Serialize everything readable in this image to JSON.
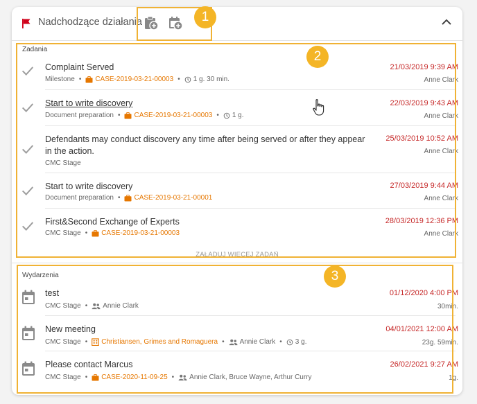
{
  "header": {
    "title": "Nadchodzące działania",
    "icons": [
      "flag-icon",
      "add-task-icon",
      "add-event-icon",
      "chevron-up-icon"
    ]
  },
  "annotations": {
    "b1": "1",
    "b2": "2",
    "b3": "3"
  },
  "colors": {
    "accent": "#f4b526",
    "date": "#c62828",
    "case": "#e67700",
    "flag": "#d0021b"
  },
  "tasks": {
    "label": "Zadania",
    "items": [
      {
        "title": "Complaint Served",
        "type": "Milestone",
        "case": "CASE-2019-03-21-00003",
        "duration": "1 g. 30 min.",
        "date": "21/03/2019 9:39 AM",
        "user": "Anne Clark"
      },
      {
        "title": "Start to write discovery",
        "type": "Document preparation",
        "case": "CASE-2019-03-21-00003",
        "duration": "1 g.",
        "date": "22/03/2019 9:43 AM",
        "user": "Anne Clark"
      },
      {
        "title1": "Defendants may conduct discovery any time after being served or after they appear",
        "title2": "in the action.",
        "type": "CMC Stage",
        "date": "25/03/2019 10:52 AM",
        "user": "Anne Clark"
      },
      {
        "title": "Start to write discovery",
        "type": "Document preparation",
        "case": "CASE-2019-03-21-00001",
        "date": "27/03/2019 9:44 AM",
        "user": "Anne Clark"
      },
      {
        "title": "First&Second Exchange of Experts",
        "type": "CMC Stage",
        "case": "CASE-2019-03-21-00003",
        "date": "28/03/2019 12:36 PM",
        "user": "Anne Clark"
      }
    ],
    "load_more": "ZAŁADUJ WIĘCEJ ZADAŃ"
  },
  "events": {
    "label": "Wydarzenia",
    "items": [
      {
        "title": "test",
        "type": "CMC Stage",
        "people": "Annie Clark",
        "date": "01/12/2020 4:00 PM",
        "duration": "30min."
      },
      {
        "title": "New meeting",
        "type": "CMC Stage",
        "company": "Christiansen, Grimes and Romaguera",
        "people": "Annie Clark",
        "meta_duration": "3 g.",
        "date": "04/01/2021 12:00 AM",
        "duration": "23g. 59min."
      },
      {
        "title": "Please contact Marcus",
        "type": "CMC Stage",
        "case": "CASE-2020-11-09-25",
        "people": "Annie Clark, Bruce Wayne, Arthur Curry",
        "date": "26/02/2021 9:27 AM",
        "duration": "1g."
      }
    ]
  }
}
